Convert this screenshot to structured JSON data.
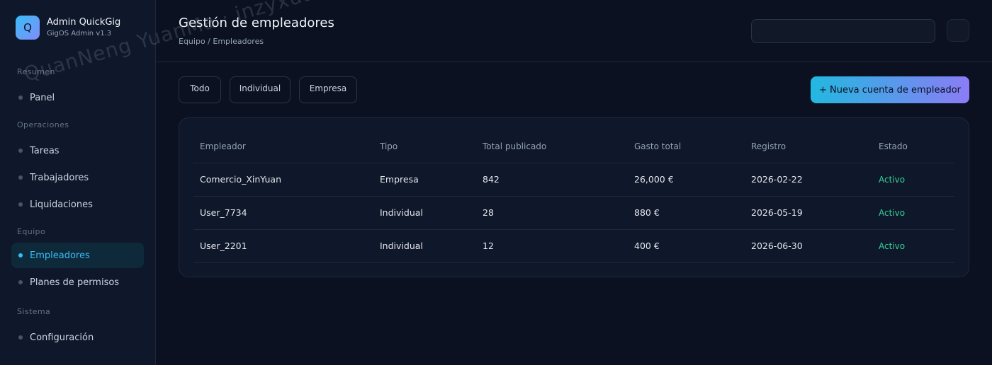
{
  "brand": {
    "logo_letter": "Q",
    "name": "Admin QuickGig",
    "version": "GigOS Admin v1.3"
  },
  "sidebar": {
    "sections": [
      {
        "title": "Resumen",
        "items": [
          {
            "label": "Panel",
            "active": false
          }
        ]
      },
      {
        "title": "Operaciones",
        "items": [
          {
            "label": "Tareas",
            "active": false
          },
          {
            "label": "Trabajadores",
            "active": false
          },
          {
            "label": "Liquidaciones",
            "active": false
          }
        ]
      },
      {
        "title": "Equipo",
        "items": [
          {
            "label": "Empleadores",
            "active": true
          },
          {
            "label": "Planes de permisos",
            "active": false
          }
        ]
      },
      {
        "title": "Sistema",
        "items": [
          {
            "label": "Configuración",
            "active": false
          }
        ]
      }
    ]
  },
  "header": {
    "title": "Gestión de empleadores",
    "breadcrumb": "Equipo / Empleadores",
    "search_placeholder": ""
  },
  "filters": [
    "Todo",
    "Individual",
    "Empresa"
  ],
  "toolbar": {
    "new_account_label": "+ Nueva cuenta de empleador"
  },
  "table": {
    "headers": [
      "Empleador",
      "Tipo",
      "Total publicado",
      "Gasto total",
      "Registro",
      "Estado"
    ],
    "rows": [
      [
        "Comercio_XinYuan",
        "Empresa",
        "842",
        "26,000 €",
        "2026-02-22",
        "Activo"
      ],
      [
        "User_7734",
        "Individual",
        "28",
        "880 €",
        "2026-05-19",
        "Activo"
      ],
      [
        "User_2201",
        "Individual",
        "12",
        "400 €",
        "2026-06-30",
        "Activo"
      ]
    ]
  },
  "watermark": "QuanNeng YuanMa · inzyxuashop.com",
  "colors": {
    "accent": "#38bdf8",
    "status_active": "#34d399",
    "bg": "#0b1120",
    "panel": "#0f172a"
  }
}
